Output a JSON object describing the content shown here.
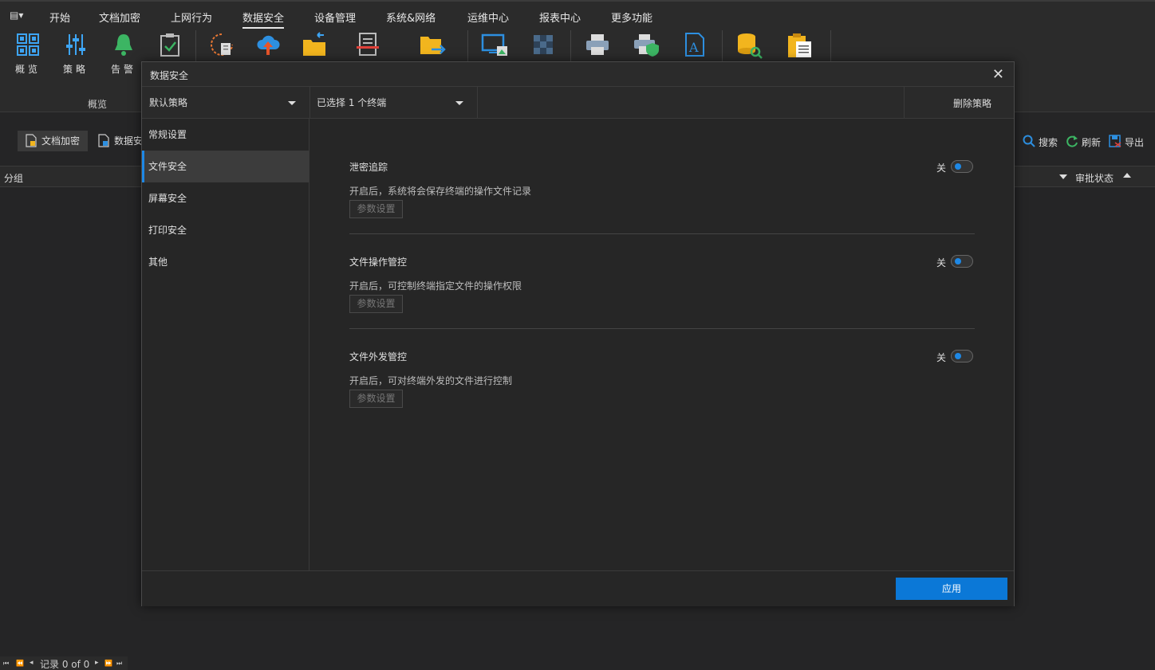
{
  "menu": {
    "toggle_glyph": "▤▾",
    "items": [
      "开始",
      "文档加密",
      "上网行为",
      "数据安全",
      "设备管理",
      "系统&网络",
      "运维中心",
      "报表中心",
      "更多功能"
    ],
    "active_index": 3
  },
  "ribbon": {
    "buttons": [
      {
        "label": "概览",
        "icon": "grid-icon"
      },
      {
        "label": "策略",
        "icon": "sliders-icon"
      },
      {
        "label": "告警",
        "icon": "bell-icon"
      }
    ],
    "group_label": "概览",
    "extra_icons": [
      "clipboard-check-icon",
      "refresh-doc-icon",
      "cloud-upload-icon",
      "folder-return-icon",
      "document-erase-icon",
      "folder-export-icon",
      "screen-image-icon",
      "mosaic-icon",
      "printer-icon",
      "printer-shield-icon",
      "font-file-icon",
      "database-search-icon",
      "clipboard-doc-icon"
    ]
  },
  "subbar": {
    "tabs": [
      "文档加密",
      "数据安"
    ],
    "search": "搜索",
    "refresh": "刷新",
    "export": "导出"
  },
  "grid": {
    "col_group": "分组",
    "col_approval": "审批状态"
  },
  "status": {
    "records": "记录 0 of 0",
    "nav_first": "⏮",
    "nav_prev_page": "⏪",
    "nav_prev": "◂",
    "nav_next": "▸",
    "nav_next_page": "⏩",
    "nav_last": "⏭"
  },
  "dialog": {
    "title": "数据安全",
    "close": "✕",
    "policy_select": "默认策略",
    "terminal_select": "已选择 1 个终端",
    "delete_policy": "删除策略",
    "nav": [
      "常规设置",
      "文件安全",
      "屏幕安全",
      "打印安全",
      "其他"
    ],
    "active_nav": 1,
    "sections": [
      {
        "title": "泄密追踪",
        "desc": "开启后，系统将会保存终端的操作文件记录",
        "button": "参数设置",
        "toggle_label": "关",
        "enabled": false
      },
      {
        "title": "文件操作管控",
        "desc": "开启后，可控制终端指定文件的操作权限",
        "button": "参数设置",
        "toggle_label": "关",
        "enabled": false
      },
      {
        "title": "文件外发管控",
        "desc": "开启后，可对终端外发的文件进行控制",
        "button": "参数设置",
        "toggle_label": "关",
        "enabled": false
      }
    ],
    "apply": "应用"
  },
  "colors": {
    "accent": "#0b78d7",
    "background": "#252526",
    "panel": "#2b2b2b"
  }
}
